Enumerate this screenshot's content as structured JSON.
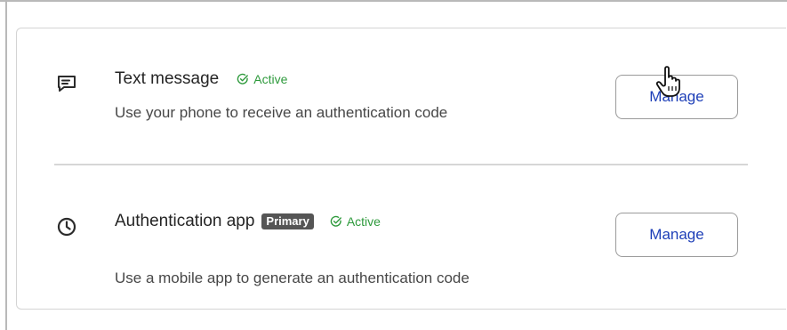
{
  "methods": [
    {
      "icon": "message-icon",
      "title": "Text message",
      "badge": "",
      "status_icon": "check-circle-icon",
      "status": "Active",
      "description": "Use your phone to receive an authentication code",
      "button_label": "Manage"
    },
    {
      "icon": "clock-icon",
      "title": "Authentication app",
      "badge": "Primary",
      "status_icon": "check-circle-icon",
      "status": "Active",
      "description": "Use a mobile app to generate an authentication code",
      "button_label": "Manage"
    }
  ],
  "cursor": {
    "icon": "hand-pointer-icon"
  },
  "colors": {
    "active_status": "#2e9a3c",
    "button_text": "#1f40b8",
    "badge_background": "#555555",
    "divider": "#d6d6d6"
  }
}
